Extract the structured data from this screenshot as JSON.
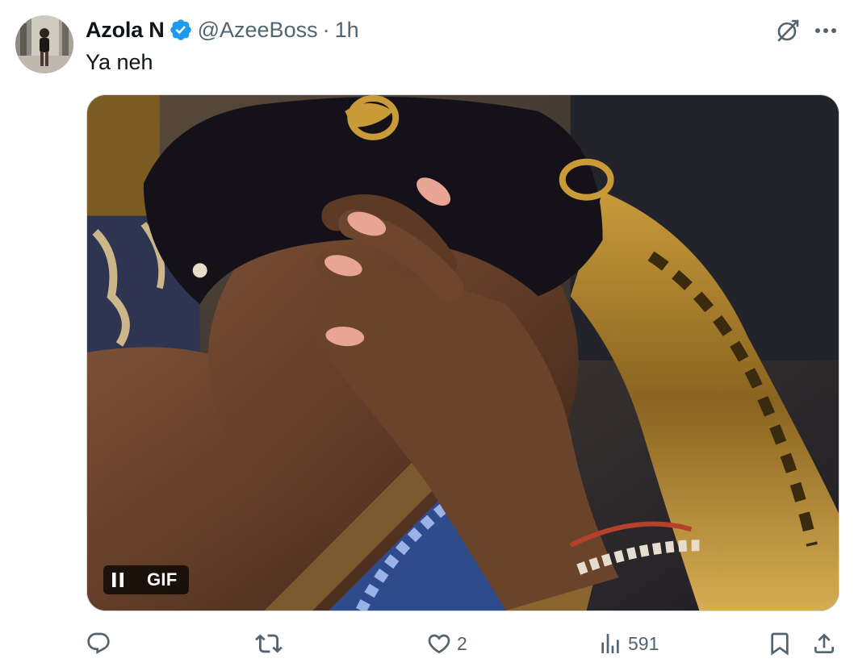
{
  "post": {
    "author": {
      "name": "Azola N",
      "handle": "@AzeeBoss",
      "verified": true,
      "verified_color": "#1d9bf0"
    },
    "separator": "·",
    "time": "1h",
    "text": "Ya neh",
    "media": {
      "type": "gif",
      "badge_label": "GIF",
      "playback_state": "playing"
    },
    "actions": {
      "reply": {
        "icon": "reply-icon",
        "count": ""
      },
      "repost": {
        "icon": "repost-icon",
        "count": ""
      },
      "like": {
        "icon": "heart-icon",
        "count": "2"
      },
      "views": {
        "icon": "views-icon",
        "count": "591"
      },
      "bookmark": {
        "icon": "bookmark-icon"
      },
      "share": {
        "icon": "share-icon"
      }
    }
  },
  "colors": {
    "text_primary": "#0f1419",
    "text_secondary": "#536471",
    "border": "#cfd9de",
    "accent": "#1d9bf0"
  }
}
